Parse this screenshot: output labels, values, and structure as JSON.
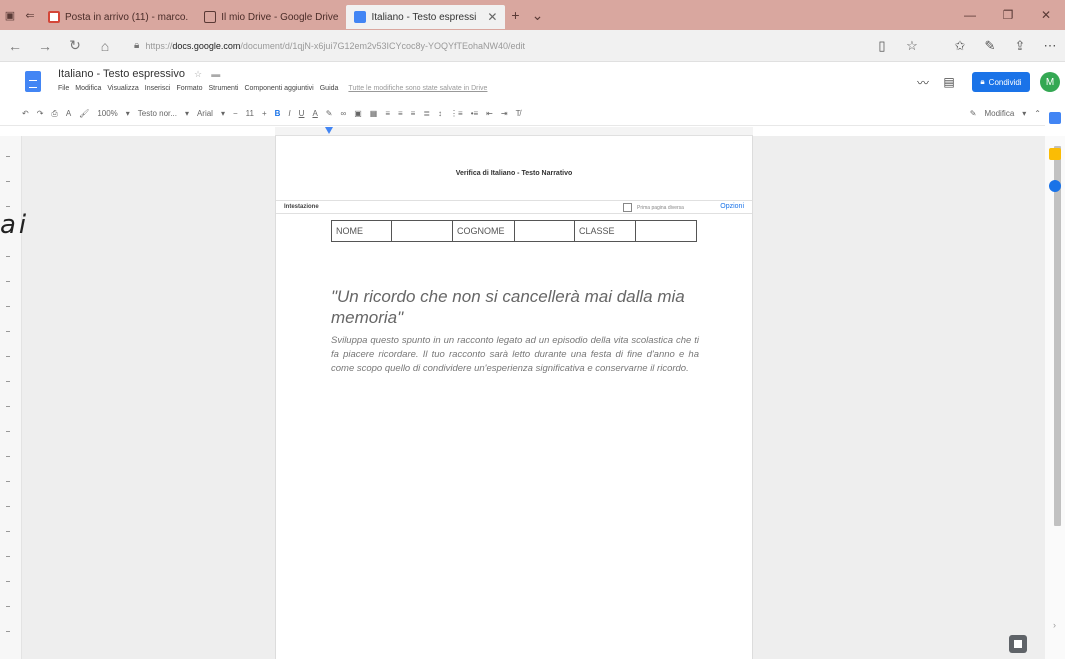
{
  "browser": {
    "tabs": [
      {
        "label": "Posta in arrivo (11) - marco.",
        "active": false,
        "icon": "mail-icon"
      },
      {
        "label": "Il mio Drive - Google Drive",
        "active": false,
        "icon": "drive-icon"
      },
      {
        "label": "Italiano - Testo espressi",
        "active": true,
        "icon": "docs-icon"
      }
    ],
    "url_prefix": "https://",
    "url_domain": "docs.google.com",
    "url_path": "/document/d/1qjN-x6jui7G12em2v53ICYcoc8y-YOQYfTEohaNW40/edit"
  },
  "docs": {
    "title": "Italiano - Testo espressivo",
    "menu": [
      "File",
      "Modifica",
      "Visualizza",
      "Inserisci",
      "Formato",
      "Strumenti",
      "Componenti aggiuntivi",
      "Guida"
    ],
    "saved_status": "Tutte le modifiche sono state salvate in Drive",
    "share_label": "Condividi",
    "avatar_letter": "M"
  },
  "toolbar": {
    "zoom": "100%",
    "style": "Testo nor...",
    "font": "Arial",
    "size": "11",
    "mode": "Modifica"
  },
  "page": {
    "heading": "Verifica di Italiano - Testo Narrativo",
    "header_label": "Intestazione",
    "first_page_label": "Prima pagina diversa",
    "options_label": "Opzioni",
    "table": [
      "NOME",
      "",
      "COGNOME",
      "",
      "CLASSE",
      ""
    ],
    "essay_title": "\"Un ricordo che non si cancellerà mai dalla mia memoria\"",
    "essay_body": "Sviluppa questo spunto in un racconto legato ad un episodio della vita scolastica che ti fa piacere ricordare. Il tuo racconto sarà letto durante una festa di fine d'anno e ha come scopo quello di condividere un'esperienza significativa e conservarne il ricordo."
  },
  "stray_text": "ai",
  "colors": {
    "tab_bar": "#d9a79f",
    "accent": "#1a73e8",
    "avatar": "#34a853",
    "docs_blue": "#4285f4"
  }
}
